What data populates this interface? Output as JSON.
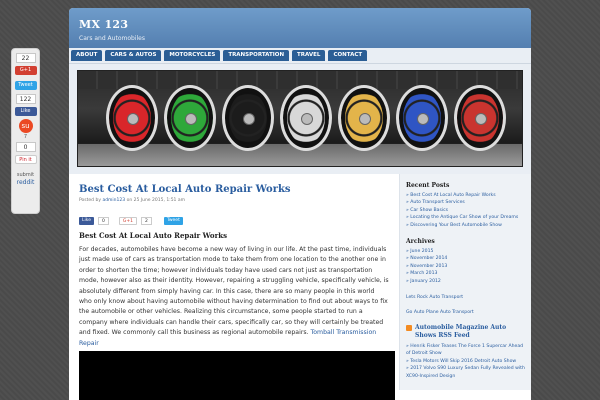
{
  "share_bar": {
    "count_top": "22",
    "gplus": "G+1",
    "tweet": "Tweet",
    "count_like": "122",
    "like": "Like",
    "stumble": "su",
    "count_stumble": "7",
    "count_pin": "0",
    "pin": "Pin it",
    "submit": "submit",
    "reddit": "reddit"
  },
  "site": {
    "title": "MX 123",
    "tagline": "Cars and Automobiles"
  },
  "nav": {
    "items": [
      "ABOUT",
      "CARS & AUTOS",
      "MOTORCYCLES",
      "TRANSPORTATION",
      "TRAVEL",
      "CONTACT"
    ]
  },
  "hero": {
    "wheel_colors": [
      "#d9262a",
      "#2ea83a",
      "#1c1c1c",
      "#d8d8d8",
      "#e3b44a",
      "#2f55c4",
      "#c9342f"
    ]
  },
  "post": {
    "title": "Best Cost At Local Auto Repair Works",
    "meta_posted": "Posted by",
    "meta_author": "admin123",
    "meta_on": "on 25 June 2015, 1:51 am",
    "like_label": "Like",
    "like_count": "0",
    "gplus_label": "G+1",
    "gplus_count": "2",
    "tweet_label": "Tweet",
    "subheading": "Best Cost At Local Auto Repair Works",
    "body": "For decades, automobiles have become a new way of living in our life. At the past time, individuals just made use of cars as transportation mode to take them from one location to the another one in order to shorten the time; however individuals today have used cars not just as transportation mode, however also as their identity. However, repairing a struggling vehicle, specifically vehicle, is absolutely different from simply having car. In this case, there are so many people in this world who only know about having automobile without having determination to find out about ways to fix the automobile or other vehicles. Realizing this circumstance, some people started to run a company where individuals can handle their cars, specifically car, so they will certainly be treated and fixed. We commonly call this business as regional automobile repairs.",
    "link": "Tomball Transmission Repair"
  },
  "sidebar": {
    "recent_title": "Recent Posts",
    "recent": [
      "Best Cost At Local Auto Repair Works",
      "Auto Transport Services",
      "Car Show Basics",
      "Locating the Antique Car Show of your Dreams",
      "Discovering Your Best Automobile Show"
    ],
    "archives_title": "Archives",
    "archives": [
      "June 2015",
      "November 2014",
      "November 2013",
      "March 2013",
      "January 2012"
    ],
    "link1": "Lets Rock Auto Transport",
    "link2": "Go Auto Plane Auto Transport",
    "rss_title": "Automobile Magazine Auto Shows RSS Feed",
    "rss_items": [
      "Henrik Fisker Teases The Force 1 Supercar Ahead of Detroit Show",
      "Tesla Motors Will Skip 2016 Detroit Auto Show",
      "2017 Volvo S90 Luxury Sedan Fully Revealed with XC90-Inspired Design"
    ]
  }
}
